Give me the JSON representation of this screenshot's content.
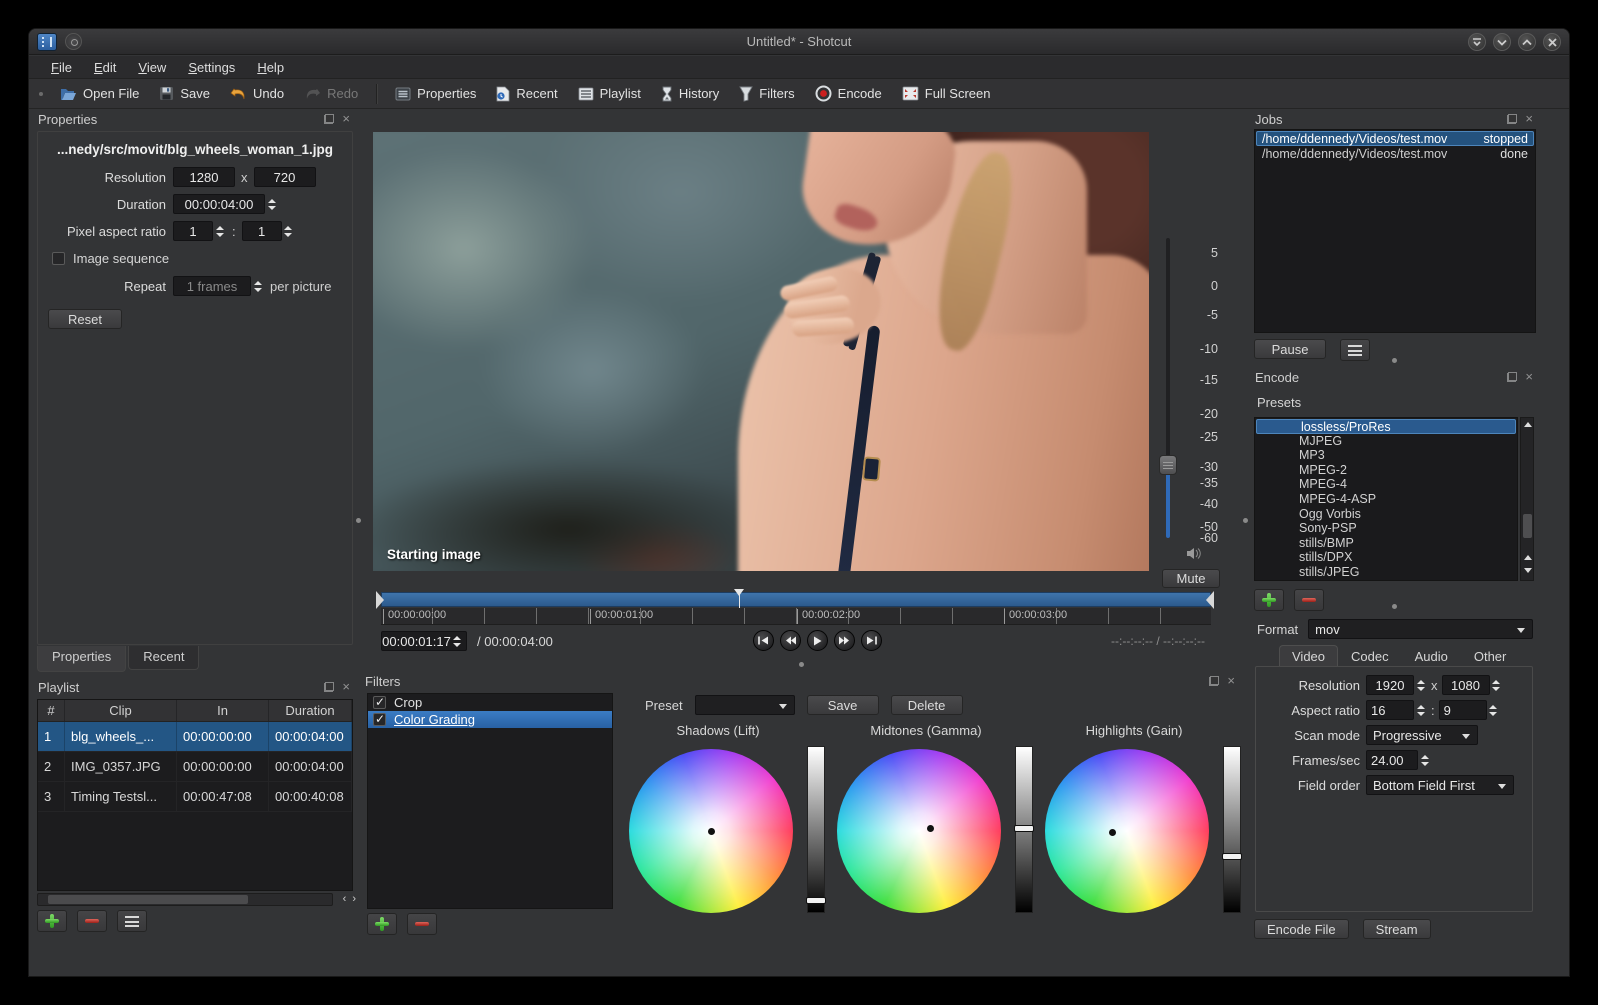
{
  "colors": {
    "accent": "#2f6ab8",
    "selection": "#24527e",
    "timeline_bar": "#2c5a8d",
    "selected_row": "#235685"
  },
  "window": {
    "title": "Untitled* - Shotcut"
  },
  "menu": {
    "items": [
      "File",
      "Edit",
      "View",
      "Settings",
      "Help"
    ]
  },
  "toolbar": {
    "buttons": [
      {
        "label": "Open File",
        "icon": "open-file-icon"
      },
      {
        "label": "Save",
        "icon": "save-icon"
      },
      {
        "label": "Undo",
        "icon": "undo-icon"
      },
      {
        "label": "Redo",
        "icon": "redo-icon",
        "disabled": true
      },
      {
        "label": "Properties",
        "icon": "properties-icon"
      },
      {
        "label": "Recent",
        "icon": "recent-icon"
      },
      {
        "label": "Playlist",
        "icon": "playlist-icon"
      },
      {
        "label": "History",
        "icon": "history-icon"
      },
      {
        "label": "Filters",
        "icon": "filters-icon"
      },
      {
        "label": "Encode",
        "icon": "encode-icon"
      },
      {
        "label": "Full Screen",
        "icon": "fullscreen-icon"
      }
    ]
  },
  "properties": {
    "title": "Properties",
    "filename": "...nedy/src/movit/blg_wheels_woman_1.jpg",
    "resolution_label": "Resolution",
    "resolution_w": "1280",
    "resolution_x": "x",
    "resolution_h": "720",
    "duration_label": "Duration",
    "duration": "00:00:04:00",
    "par_label": "Pixel aspect ratio",
    "par_num": "1",
    "par_sep": ":",
    "par_den": "1",
    "image_sequence_label": "Image sequence",
    "repeat_label": "Repeat",
    "repeat_value": "1 frames",
    "repeat_suffix": "per picture",
    "reset_label": "Reset",
    "dock_tabs": [
      {
        "label": "Properties",
        "active": true
      },
      {
        "label": "Recent"
      }
    ]
  },
  "playlist": {
    "title": "Playlist",
    "columns": [
      "#",
      "Clip",
      "In",
      "Duration"
    ],
    "rows": [
      {
        "num": "1",
        "clip": "blg_wheels_...",
        "in": "00:00:00:00",
        "duration": "00:00:04:00",
        "selected": true
      },
      {
        "num": "2",
        "clip": "IMG_0357.JPG",
        "in": "00:00:00:00",
        "duration": "00:00:04:00"
      },
      {
        "num": "3",
        "clip": "Timing Testsl...",
        "in": "00:00:47:08",
        "duration": "00:00:40:08"
      }
    ]
  },
  "preview": {
    "overlay": "Starting image"
  },
  "volume": {
    "scale": [
      "5",
      "0",
      "-5",
      "-10",
      "-15",
      "-20",
      "-25",
      "-30",
      "-35",
      "-40",
      "-50",
      "-60"
    ],
    "mute_label": "Mute"
  },
  "transport": {
    "ruler": [
      "00:00:00:00",
      "00:00:01:00",
      "00:00:02:00",
      "00:00:03:00"
    ],
    "current": "00:00:01:17",
    "total": "/ 00:00:04:00",
    "range": "--:--:--:--  /  --:--:--:--"
  },
  "filters": {
    "title": "Filters",
    "items": [
      {
        "label": "Crop",
        "checked": true
      },
      {
        "label": "Color Grading",
        "checked": true,
        "selected": true
      }
    ],
    "preset_label": "Preset",
    "save_label": "Save",
    "delete_label": "Delete",
    "wheels": [
      {
        "title": "Shadows (Lift)"
      },
      {
        "title": "Midtones (Gamma)"
      },
      {
        "title": "Highlights (Gain)"
      }
    ]
  },
  "jobs": {
    "title": "Jobs",
    "rows": [
      {
        "path": "/home/ddennedy/Videos/test.mov",
        "status": "stopped",
        "selected": true
      },
      {
        "path": "/home/ddennedy/Videos/test.mov",
        "status": "done"
      }
    ],
    "pause_label": "Pause"
  },
  "encode": {
    "title": "Encode",
    "presets_label": "Presets",
    "presets": [
      {
        "label": "lossless/ProRes",
        "selected": true
      },
      {
        "label": "MJPEG"
      },
      {
        "label": "MP3"
      },
      {
        "label": "MPEG-2"
      },
      {
        "label": "MPEG-4"
      },
      {
        "label": "MPEG-4-ASP"
      },
      {
        "label": "Ogg Vorbis"
      },
      {
        "label": "Sony-PSP"
      },
      {
        "label": "stills/BMP"
      },
      {
        "label": "stills/DPX"
      },
      {
        "label": "stills/JPEG"
      }
    ],
    "format_label": "Format",
    "format_value": "mov",
    "tabs": [
      {
        "label": "Video",
        "active": true
      },
      {
        "label": "Codec"
      },
      {
        "label": "Audio"
      },
      {
        "label": "Other"
      }
    ],
    "video": {
      "resolution_label": "Resolution",
      "res_w": "1920",
      "res_x": "x",
      "res_h": "1080",
      "aspect_label": "Aspect ratio",
      "aspect_w": "16",
      "aspect_sep": ":",
      "aspect_h": "9",
      "scan_label": "Scan mode",
      "scan_value": "Progressive",
      "fps_label": "Frames/sec",
      "fps_value": "24.00",
      "field_label": "Field order",
      "field_value": "Bottom Field First"
    },
    "encode_file_label": "Encode File",
    "stream_label": "Stream"
  }
}
